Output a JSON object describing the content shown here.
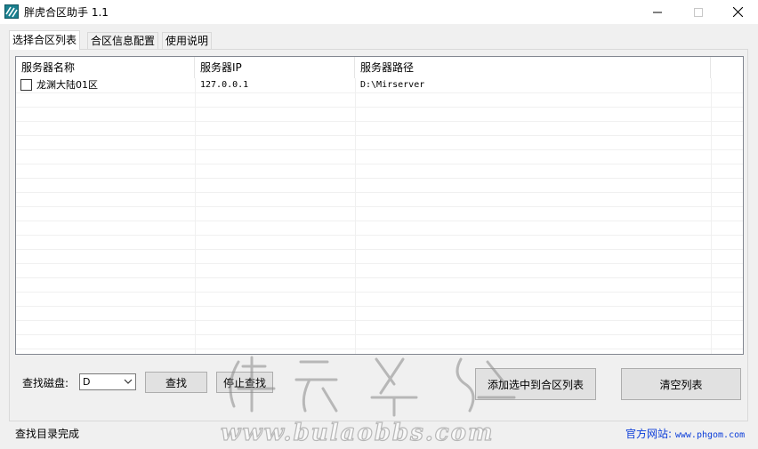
{
  "window": {
    "title": "胖虎合区助手 1.1"
  },
  "tabs": [
    {
      "label": "选择合区列表",
      "active": true
    },
    {
      "label": "合区信息配置",
      "active": false
    },
    {
      "label": "使用说明",
      "active": false
    }
  ],
  "list": {
    "columns": [
      "服务器名称",
      "服务器IP",
      "服务器路径"
    ],
    "rows": [
      {
        "checked": false,
        "name": "龙渊大陆01区",
        "ip": "127.0.0.1",
        "path": "D:\\Mirserver"
      }
    ]
  },
  "controls": {
    "disk_label": "查找磁盘:",
    "disk_value": "D",
    "find_button": "查找",
    "stop_button": "停止查找",
    "add_button": "添加选中到合区列表",
    "clear_button": "清空列表"
  },
  "status": {
    "text": "查找目录完成",
    "site_label": "官方网站:",
    "site_url": "www.phgom.com"
  },
  "watermark": {
    "text": "www.bulaobbs.com"
  },
  "icons": {
    "app": "app-logo-icon",
    "minimize": "minimize-icon",
    "maximize": "maximize-icon",
    "close": "close-icon",
    "dropdown": "chevron-down-icon"
  }
}
